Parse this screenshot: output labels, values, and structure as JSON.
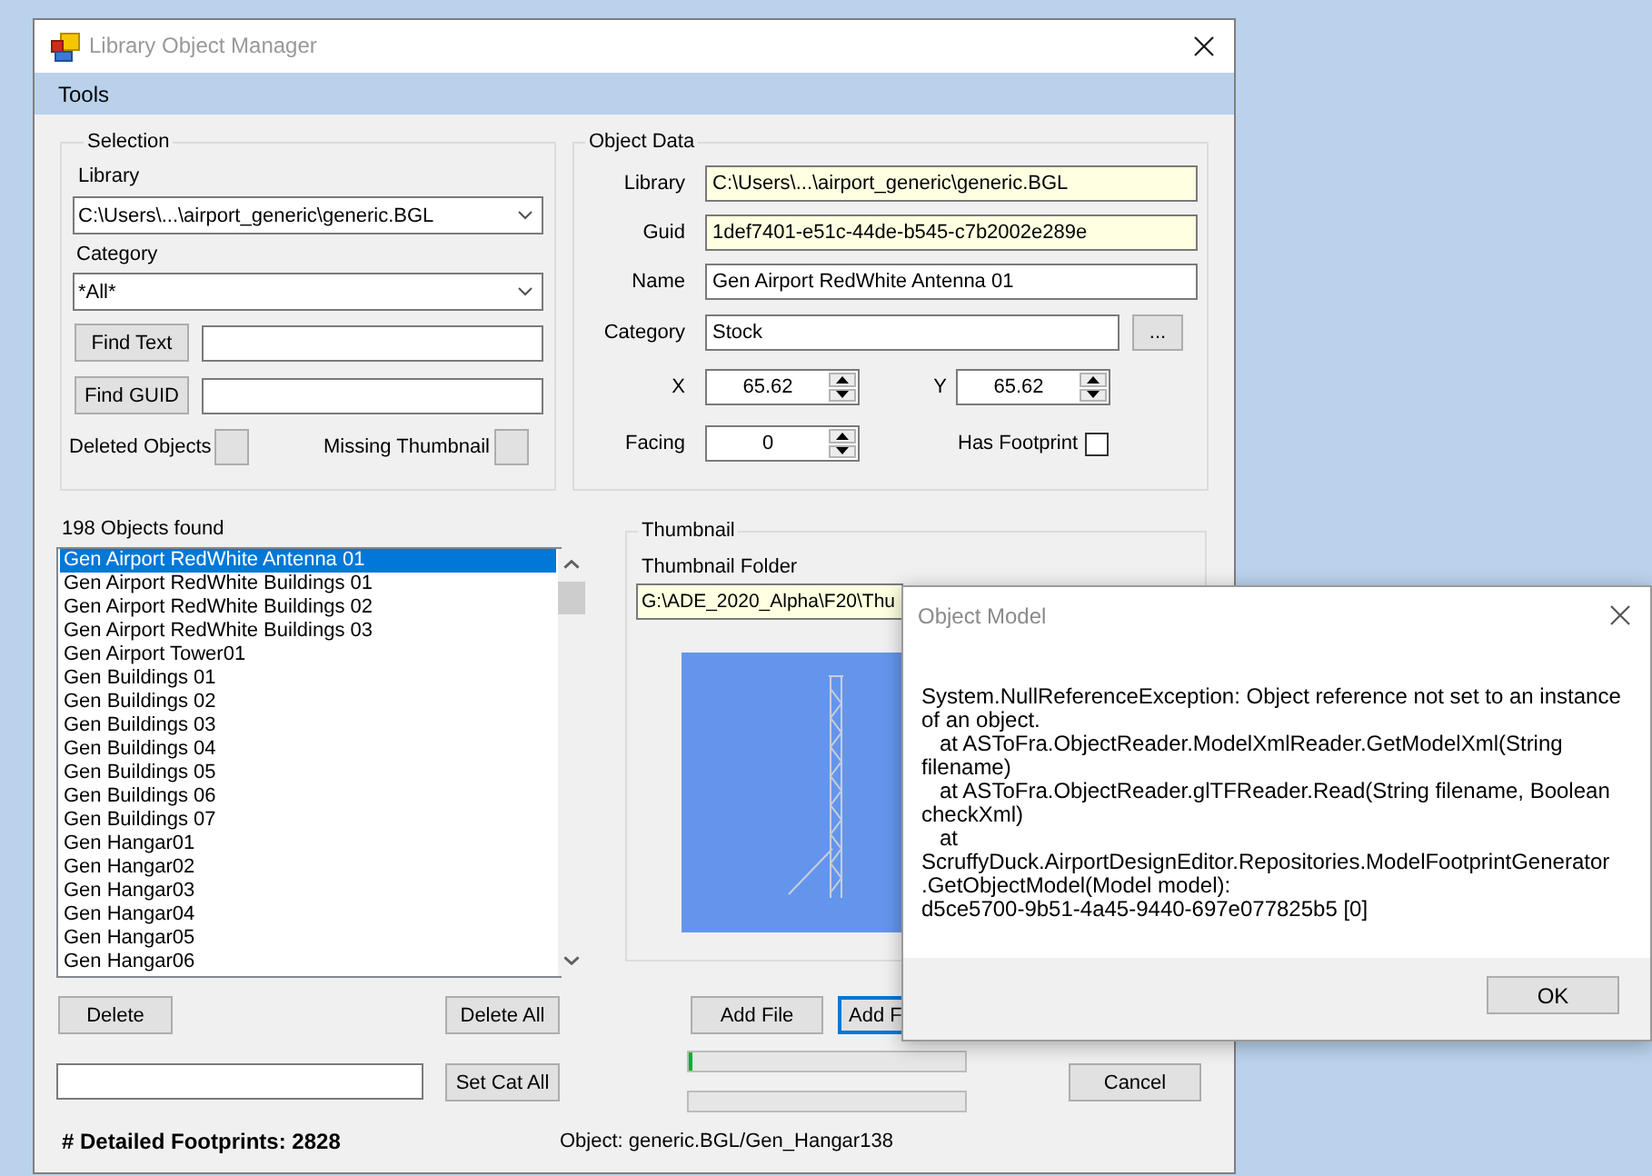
{
  "window": {
    "title": "Library Object Manager"
  },
  "menu": [
    {
      "label": "Tools"
    }
  ],
  "selection": {
    "title": "Selection",
    "library": {
      "label": "Library",
      "value": "C:\\Users\\...\\airport_generic\\generic.BGL"
    },
    "category": {
      "label": "Category",
      "value": "*All*"
    },
    "find_text": {
      "button": "Find Text"
    },
    "find_guid": {
      "button": "Find GUID"
    },
    "toggles": [
      {
        "label": "Deleted Objects",
        "checked": false
      },
      {
        "label": "Missing Thumbnail",
        "checked": false
      }
    ]
  },
  "object_data": {
    "title": "Object Data",
    "fields": [
      {
        "label": "Library",
        "value": "C:\\Users\\...\\airport_generic\\generic.BGL",
        "readonly": true
      },
      {
        "label": "Guid",
        "value": "1def7401-e51c-44de-b545-c7b2002e289e",
        "readonly": true
      },
      {
        "label": "Name",
        "value": "Gen Airport RedWhite Antenna 01",
        "readonly": false
      },
      {
        "label": "Category",
        "value": "Stock",
        "readonly": false,
        "button": "..."
      }
    ],
    "x": {
      "label": "X",
      "value": "65.62"
    },
    "y": {
      "label": "Y",
      "value": "65.62"
    },
    "facing": {
      "label": "Facing",
      "value": "0"
    },
    "has_footprint": {
      "label": "Has Footprint",
      "checked": false
    }
  },
  "objects": {
    "count": "198 Objects found",
    "items": [
      {
        "label": "Gen Airport RedWhite Antenna 01",
        "selected": true
      },
      {
        "label": "Gen Airport RedWhite Buildings 01",
        "selected": false
      },
      {
        "label": "Gen Airport RedWhite Buildings 02",
        "selected": false
      },
      {
        "label": "Gen Airport RedWhite Buildings 03",
        "selected": false
      },
      {
        "label": "Gen Airport Tower01",
        "selected": false
      },
      {
        "label": "Gen Buildings 01",
        "selected": false
      },
      {
        "label": "Gen Buildings 02",
        "selected": false
      },
      {
        "label": "Gen Buildings 03",
        "selected": false
      },
      {
        "label": "Gen Buildings 04",
        "selected": false
      },
      {
        "label": "Gen Buildings 05",
        "selected": false
      },
      {
        "label": "Gen Buildings 06",
        "selected": false
      },
      {
        "label": "Gen Buildings 07",
        "selected": false
      },
      {
        "label": "Gen Hangar01",
        "selected": false
      },
      {
        "label": "Gen Hangar02",
        "selected": false
      },
      {
        "label": "Gen Hangar03",
        "selected": false
      },
      {
        "label": "Gen Hangar04",
        "selected": false
      },
      {
        "label": "Gen Hangar05",
        "selected": false
      },
      {
        "label": "Gen Hangar06",
        "selected": false
      }
    ]
  },
  "list_buttons": [
    "Delete",
    "Delete All"
  ],
  "set_category": {
    "button": "Set Cat All"
  },
  "thumbnail": {
    "title": "Thumbnail",
    "folder_label": "Thumbnail Folder",
    "folder": {
      "value": "G:\\ADE_2020_Alpha\\F20\\Thu",
      "readonly": true
    }
  },
  "file_buttons": [
    {
      "label": "Add File",
      "focused": false
    },
    {
      "label": "Add F",
      "focused": true
    }
  ],
  "progress": [
    {
      "level": 0.01
    },
    {
      "level": 0
    }
  ],
  "cancel_button": "Cancel",
  "status": {
    "footprints": "# Detailed Footprints: 2828",
    "object": "Object: generic.BGL/Gen_Hangar138"
  },
  "dialog": {
    "title": "Object Model",
    "message": "System.NullReferenceException: Object reference not set to an instance\nof an object.\n   at ASToFra.ObjectReader.ModelXmlReader.GetModelXml(String\nfilename)\n   at ASToFra.ObjectReader.glTFReader.Read(String filename, Boolean\ncheckXml)\n   at\nScruffyDuck.AirportDesignEditor.Repositories.ModelFootprintGenerator\n.GetObjectModel(Model model):\nd5ce5700-9b51-4a45-9440-697e077825b5 [0]",
    "button": "OK"
  }
}
